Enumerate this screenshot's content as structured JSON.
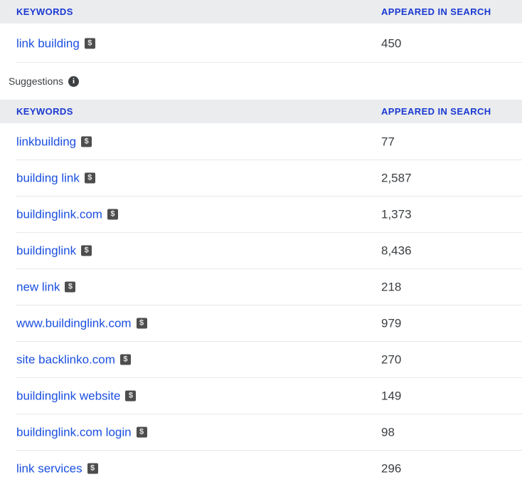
{
  "main_table": {
    "columns": {
      "keywords": "KEYWORDS",
      "appeared_in_search": "APPEARED IN SEARCH"
    },
    "rows": [
      {
        "keyword": "link building",
        "badge": "$",
        "appeared_in_search": "450"
      }
    ]
  },
  "suggestions_section": {
    "label": "Suggestions",
    "info_icon": "info-icon",
    "info_glyph": "i"
  },
  "suggestions_table": {
    "columns": {
      "keywords": "KEYWORDS",
      "appeared_in_search": "APPEARED IN SEARCH"
    },
    "rows": [
      {
        "keyword": "linkbuilding",
        "badge": "$",
        "appeared_in_search": "77"
      },
      {
        "keyword": "building link",
        "badge": "$",
        "appeared_in_search": "2,587"
      },
      {
        "keyword": "buildinglink.com",
        "badge": "$",
        "appeared_in_search": "1,373"
      },
      {
        "keyword": "buildinglink",
        "badge": "$",
        "appeared_in_search": "8,436"
      },
      {
        "keyword": "new link",
        "badge": "$",
        "appeared_in_search": "218"
      },
      {
        "keyword": "www.buildinglink.com",
        "badge": "$",
        "appeared_in_search": "979"
      },
      {
        "keyword": "site backlinko.com",
        "badge": "$",
        "appeared_in_search": "270"
      },
      {
        "keyword": "buildinglink website",
        "badge": "$",
        "appeared_in_search": "149"
      },
      {
        "keyword": "buildinglink.com login",
        "badge": "$",
        "appeared_in_search": "98"
      },
      {
        "keyword": "link services",
        "badge": "$",
        "appeared_in_search": "296"
      }
    ]
  },
  "colors": {
    "header_text": "#1a39d2",
    "header_background": "#eaecee",
    "link": "#1a4fe0",
    "value_text": "#3c4043",
    "row_divider": "#e8e8e8",
    "badge_background": "#4d4d4d"
  }
}
